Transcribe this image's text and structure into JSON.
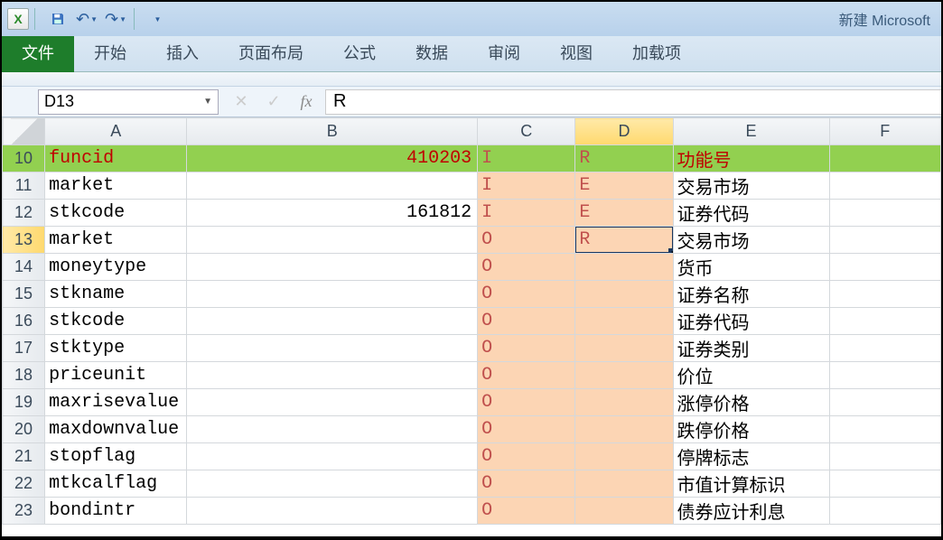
{
  "app": {
    "title": "新建 Microsoft"
  },
  "qat": {
    "save": "save",
    "undo": "undo",
    "redo": "redo"
  },
  "tabs": {
    "file": "文件",
    "home": "开始",
    "insert": "插入",
    "layout": "页面布局",
    "formula": "公式",
    "data": "数据",
    "review": "审阅",
    "view": "视图",
    "addin": "加载项"
  },
  "formula_bar": {
    "name_box": "D13",
    "fx": "fx",
    "value": "R"
  },
  "columns": [
    "A",
    "B",
    "C",
    "D",
    "E",
    "F"
  ],
  "selected": {
    "row": 13,
    "col": "D"
  },
  "rows": [
    {
      "n": 10,
      "a": "funcid",
      "b": "410203",
      "c": "I",
      "d": "R",
      "e": "功能号",
      "hdr": true,
      "peachC": false,
      "peachD": false
    },
    {
      "n": 11,
      "a": "market",
      "b": "",
      "c": "I",
      "d": "E",
      "e": "交易市场",
      "peachC": true,
      "peachD": true
    },
    {
      "n": 12,
      "a": "stkcode",
      "b": "161812",
      "c": "I",
      "d": "E",
      "e": "证券代码",
      "peachC": true,
      "peachD": true
    },
    {
      "n": 13,
      "a": "market",
      "b": "",
      "c": "O",
      "d": "R",
      "e": "交易市场",
      "peachC": true,
      "peachD": true,
      "sel": true
    },
    {
      "n": 14,
      "a": "moneytype",
      "b": "",
      "c": "O",
      "d": "",
      "e": "货币",
      "peachC": true,
      "peachD": true
    },
    {
      "n": 15,
      "a": "stkname",
      "b": "",
      "c": "O",
      "d": "",
      "e": "证券名称",
      "peachC": true,
      "peachD": true
    },
    {
      "n": 16,
      "a": "stkcode",
      "b": "",
      "c": "O",
      "d": "",
      "e": "证券代码",
      "peachC": true,
      "peachD": true
    },
    {
      "n": 17,
      "a": "stktype",
      "b": "",
      "c": "O",
      "d": "",
      "e": "证券类别",
      "peachC": true,
      "peachD": true
    },
    {
      "n": 18,
      "a": "priceunit",
      "b": "",
      "c": "O",
      "d": "",
      "e": "价位",
      "peachC": true,
      "peachD": true
    },
    {
      "n": 19,
      "a": "maxrisevalue",
      "b": "",
      "c": "O",
      "d": "",
      "e": "涨停价格",
      "peachC": true,
      "peachD": true
    },
    {
      "n": 20,
      "a": "maxdownvalue",
      "b": "",
      "c": "O",
      "d": "",
      "e": "跌停价格",
      "peachC": true,
      "peachD": true
    },
    {
      "n": 21,
      "a": "stopflag",
      "b": "",
      "c": "O",
      "d": "",
      "e": "停牌标志",
      "peachC": true,
      "peachD": true
    },
    {
      "n": 22,
      "a": "mtkcalflag",
      "b": "",
      "c": "O",
      "d": "",
      "e": "市值计算标识",
      "peachC": true,
      "peachD": true
    },
    {
      "n": 23,
      "a": "bondintr",
      "b": "",
      "c": "O",
      "d": "",
      "e": "债券应计利息",
      "peachC": true,
      "peachD": true
    }
  ]
}
